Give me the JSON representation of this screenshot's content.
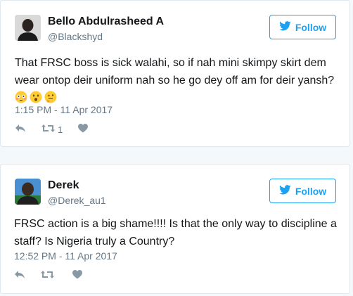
{
  "tweets": [
    {
      "name": "Bello Abdulrasheed A",
      "handle": "@Blackshyd",
      "follow_label": "Follow",
      "text": "That FRSC boss is sick walahi, so if nah mini skimpy skirt dem wear ontop deir uniform nah so he go dey off am for deir yansh?",
      "emojis": [
        "flushed-face",
        "hushed-face",
        "thinking-face"
      ],
      "time": "1:15 PM - 11 Apr 2017",
      "retweet_count": "1"
    },
    {
      "name": "Derek",
      "handle": "@Derek_au1",
      "follow_label": "Follow",
      "text": "FRSC action is a big shame!!!! Is that the only way to discipline a staff? Is Nigeria truly a Country?",
      "time": "12:52 PM - 11 Apr 2017",
      "retweet_count": ""
    }
  ],
  "colors": {
    "accent": "#1da1f2",
    "muted": "#657786",
    "icon": "#8899a6",
    "border": "#e1e8ed"
  }
}
